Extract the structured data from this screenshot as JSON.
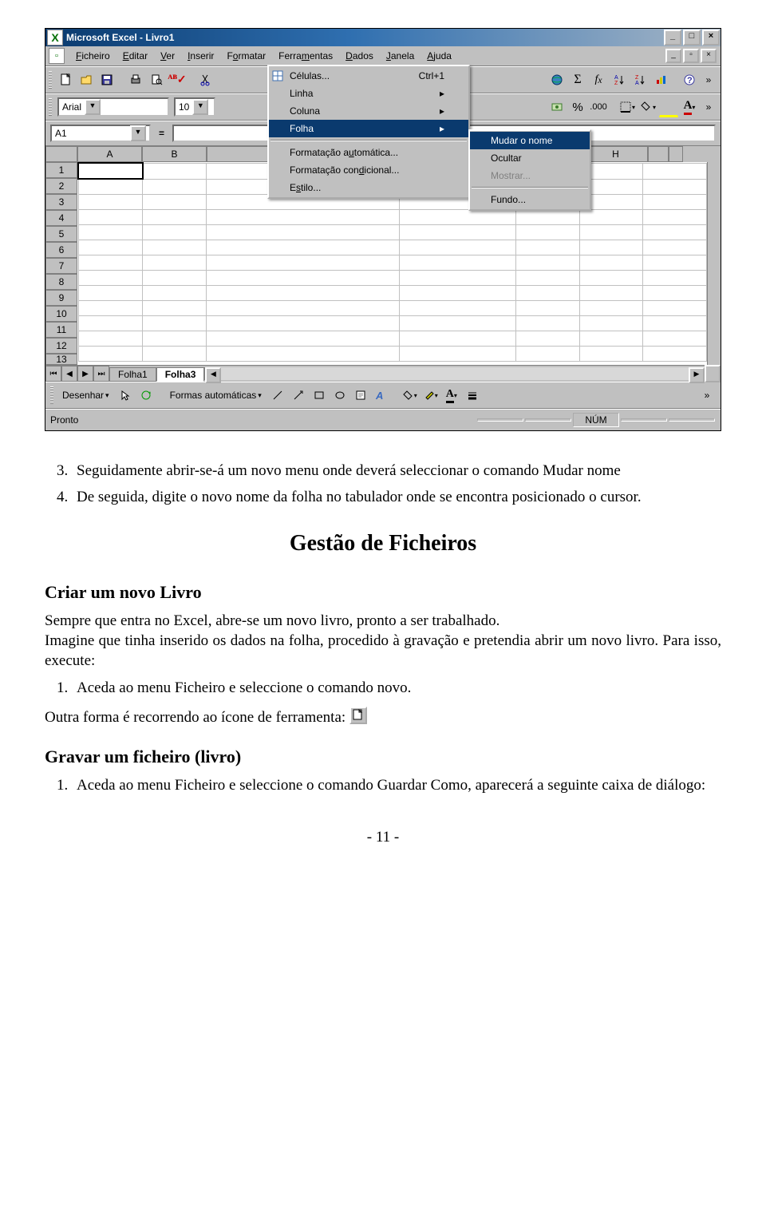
{
  "window": {
    "title": "Microsoft Excel - Livro1"
  },
  "menubar": {
    "items": [
      "Ficheiro",
      "Editar",
      "Ver",
      "Inserir",
      "Formatar",
      "Ferramentas",
      "Dados",
      "Janela",
      "Ajuda"
    ],
    "underlines": [
      "F",
      "E",
      "V",
      "I",
      "o",
      "m",
      "D",
      "J",
      "A"
    ]
  },
  "font_combo": {
    "value": "Arial"
  },
  "size_combo": {
    "value": "10"
  },
  "namebox": {
    "value": "A1"
  },
  "columns": [
    "A",
    "B",
    "",
    "",
    "",
    "",
    "",
    "H"
  ],
  "rows": [
    "1",
    "2",
    "3",
    "4",
    "5",
    "6",
    "7",
    "8",
    "9",
    "10",
    "11",
    "12",
    "13"
  ],
  "format_menu": {
    "cells": {
      "label": "Células...",
      "kb": "Ctrl+1"
    },
    "row": {
      "label": "Linha"
    },
    "col": {
      "label": "Coluna"
    },
    "sheet": {
      "label": "Folha"
    },
    "autofmt": {
      "label": "Formatação automática..."
    },
    "condfmt": {
      "label": "Formatação condicional..."
    },
    "style": {
      "label": "Estilo..."
    }
  },
  "folha_submenu": {
    "rename": "Mudar o nome",
    "hide": "Ocultar",
    "show": "Mostrar...",
    "bg": "Fundo..."
  },
  "sheet_tabs": {
    "tab1": "Folha1",
    "tab3": "Folha3"
  },
  "drawbar": {
    "draw": "Desenhar",
    "autoshapes": "Formas automáticas"
  },
  "statusbar": {
    "ready": "Pronto",
    "num": "NÚM"
  },
  "doc": {
    "li1": "Seguidamente abrir-se-á um novo menu onde deverá seleccionar o comando Mudar nome",
    "li2": "De seguida, digite o novo nome da folha no tabulador onde se encontra posicionado o cursor.",
    "h_gestao": "Gestão de Ficheiros",
    "h_criar": "Criar um novo Livro",
    "p1": "Sempre que entra no Excel, abre-se um novo livro, pronto a  ser trabalhado.",
    "p2": "Imagine que tinha inserido os dados na folha, procedido à gravação e pretendia abrir um novo livro. Para isso, execute:",
    "li_aceda": "Aceda ao menu Ficheiro e seleccione o comando novo.",
    "p_outra": "Outra forma é recorrendo ao ícone de ferramenta:",
    "h_gravar": "Gravar um ficheiro (livro)",
    "li_gravar": "Aceda ao menu Ficheiro e seleccione o comando Guardar Como, aparecerá a seguinte caixa de diálogo:",
    "pagenum": "- 11 -"
  }
}
